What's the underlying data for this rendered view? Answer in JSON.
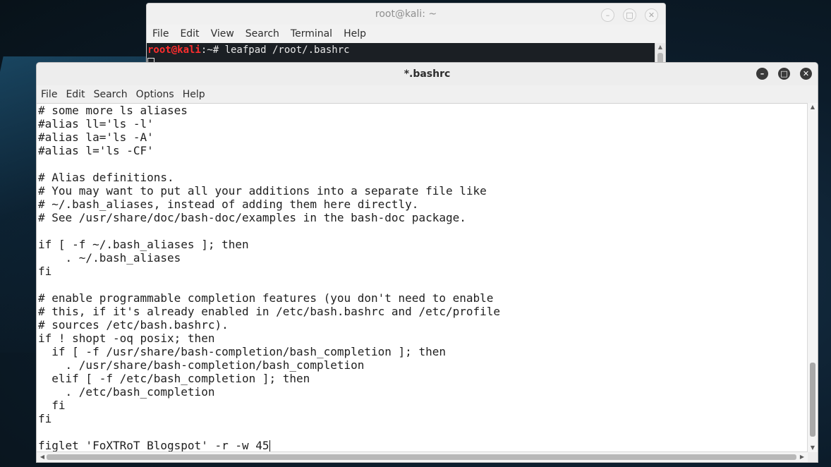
{
  "terminal": {
    "title": "root@kali: ~",
    "menu": [
      "File",
      "Edit",
      "View",
      "Search",
      "Terminal",
      "Help"
    ],
    "prompt_user": "root@kali",
    "prompt_path": ":~# ",
    "command": "leafpad /root/.bashrc",
    "buttons": {
      "minimize": "–",
      "maximize": "□",
      "close": "✕"
    }
  },
  "editor": {
    "title": "*.bashrc",
    "menu": [
      "File",
      "Edit",
      "Search",
      "Options",
      "Help"
    ],
    "buttons": {
      "minimize": "–",
      "maximize": "□",
      "close": "✕"
    },
    "text": "# some more ls aliases\n#alias ll='ls -l'\n#alias la='ls -A'\n#alias l='ls -CF'\n\n# Alias definitions.\n# You may want to put all your additions into a separate file like\n# ~/.bash_aliases, instead of adding them here directly.\n# See /usr/share/doc/bash-doc/examples in the bash-doc package.\n\nif [ -f ~/.bash_aliases ]; then\n    . ~/.bash_aliases\nfi\n\n# enable programmable completion features (you don't need to enable\n# this, if it's already enabled in /etc/bash.bashrc and /etc/profile\n# sources /etc/bash.bashrc).\nif ! shopt -oq posix; then\n  if [ -f /usr/share/bash-completion/bash_completion ]; then\n    . /usr/share/bash-completion/bash_completion\n  elif [ -f /etc/bash_completion ]; then\n    . /etc/bash_completion\n  fi\nfi\n\nfiglet 'FoXTRoT Blogspot' -r -w 45",
    "scroll_arrows": {
      "up": "▲",
      "down": "▼",
      "left": "◀",
      "right": "▶"
    }
  }
}
